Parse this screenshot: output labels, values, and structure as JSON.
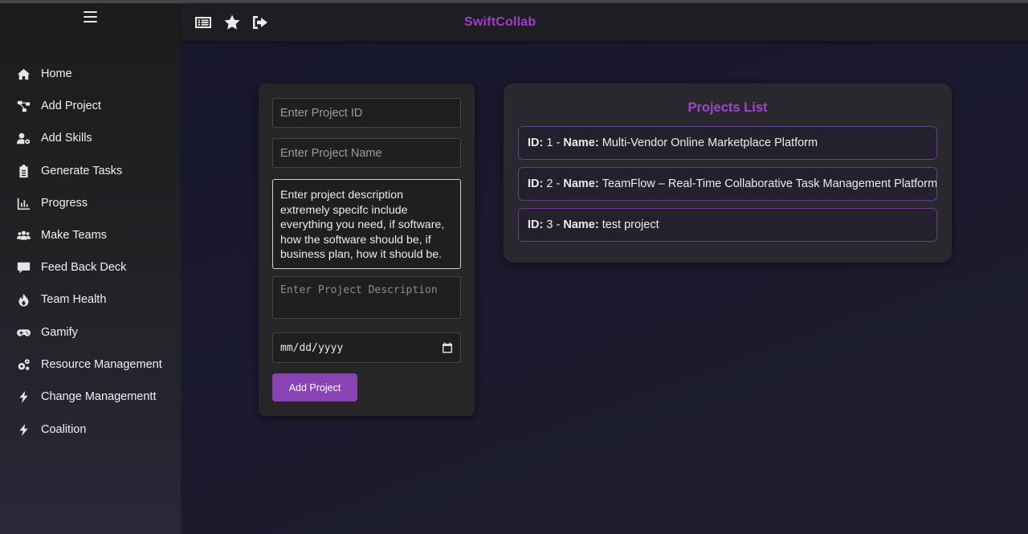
{
  "app": {
    "brand": "SwiftCollab"
  },
  "sidebar": {
    "items": [
      {
        "label": "Home",
        "icon": "home-icon"
      },
      {
        "label": "Add Project",
        "icon": "project-diagram-icon"
      },
      {
        "label": "Add Skills",
        "icon": "user-gear-icon"
      },
      {
        "label": "Generate Tasks",
        "icon": "clipboard-icon"
      },
      {
        "label": "Progress",
        "icon": "bar-chart-icon"
      },
      {
        "label": "Make Teams",
        "icon": "users-icon"
      },
      {
        "label": "Feed Back Deck",
        "icon": "comment-icon"
      },
      {
        "label": "Team Health",
        "icon": "fire-icon"
      },
      {
        "label": "Gamify",
        "icon": "gamepad-icon"
      },
      {
        "label": "Resource Management",
        "icon": "gears-icon"
      },
      {
        "label": "Change Managementt",
        "icon": "bolt-icon"
      },
      {
        "label": "Coalition",
        "icon": "bolt-icon"
      }
    ]
  },
  "form": {
    "project_id_placeholder": "Enter Project ID",
    "project_name_placeholder": "Enter Project Name",
    "description_hint": "Enter project description extremely specifc include everything you need, if software, how the software should be, if business plan, how it should be.",
    "description_placeholder": "Enter Project Description",
    "date_placeholder": "mm/dd/yyyy",
    "add_button": "Add Project"
  },
  "projects": {
    "title": "Projects List",
    "id_label": "ID:",
    "name_label": "Name:",
    "items": [
      {
        "id": "1",
        "name": "Multi-Vendor Online Marketplace Platform"
      },
      {
        "id": "2",
        "name": "TeamFlow – Real-Time Collaborative Task Management Platform"
      },
      {
        "id": "3",
        "name": "test project"
      }
    ]
  },
  "colors": {
    "accent": "#a33cc9",
    "button": "#8a43b3",
    "item_border": "#6e3a92"
  }
}
